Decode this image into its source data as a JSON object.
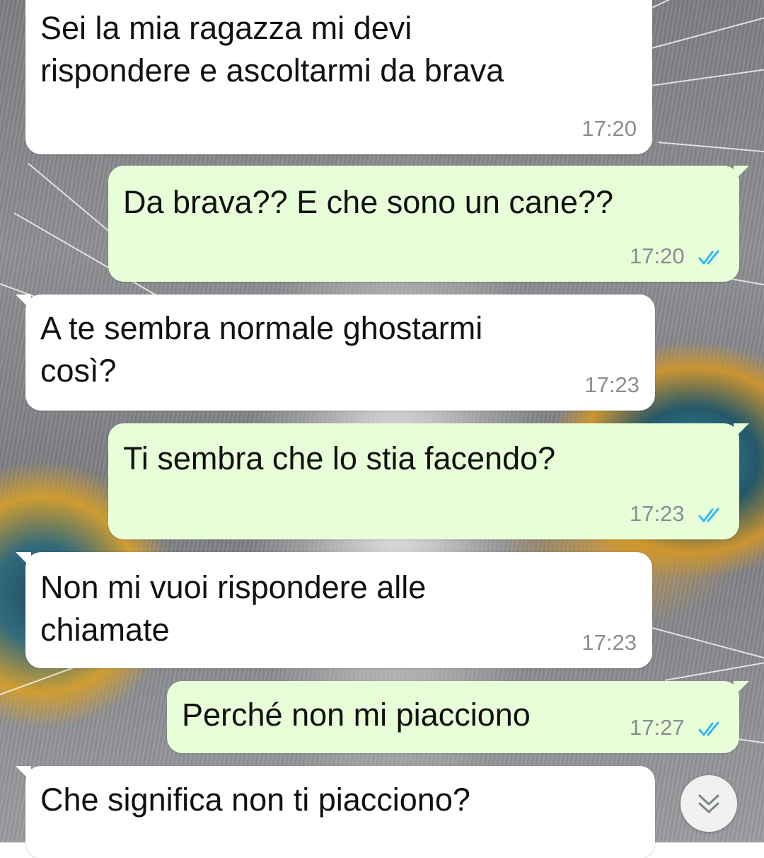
{
  "theme": {
    "incoming_bubble": "#ffffff",
    "outgoing_bubble": "#e7fed8",
    "read_tick_color": "#34b7f1",
    "time_color": "#8a8e90"
  },
  "messages": [
    {
      "direction": "incoming",
      "text": "Sei la mia ragazza mi devi\nrispondere e ascoltarmi da brava",
      "time": "17:20"
    },
    {
      "direction": "outgoing",
      "text": "Da brava?? E che sono un cane??",
      "time": "17:20",
      "status": "read"
    },
    {
      "direction": "incoming",
      "text": "A te sembra normale ghostarmi\ncosì?",
      "time": "17:23"
    },
    {
      "direction": "outgoing",
      "text": "Ti sembra che lo stia facendo?",
      "time": "17:23",
      "status": "read"
    },
    {
      "direction": "incoming",
      "text": "Non mi vuoi rispondere alle\nchiamate",
      "time": "17:23"
    },
    {
      "direction": "outgoing",
      "text": "Perché non mi piacciono",
      "time": "17:27",
      "status": "read"
    },
    {
      "direction": "incoming",
      "text": "Che significa non ti piacciono?",
      "time": ""
    }
  ],
  "controls": {
    "scroll_down_icon": "double-chevron-down-icon"
  },
  "wallpaper": {
    "subject": "cat-eyes-photo"
  }
}
